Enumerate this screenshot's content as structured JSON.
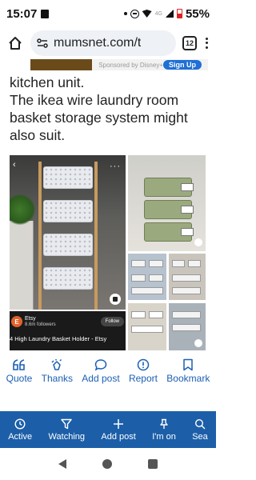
{
  "status_bar": {
    "time": "15:07",
    "network": "4G",
    "battery": "55%"
  },
  "browser": {
    "url": "mumsnet.com/t",
    "tab_count": "12"
  },
  "ad": {
    "sponsor_text": "Sponsored by Disney+",
    "cta_label": "Sign Up"
  },
  "post": {
    "lines": [
      "kitchen unit.",
      "The ikea wire laundry room basket storage system might also suit."
    ]
  },
  "pin": {
    "store_name": "Etsy",
    "followers": "8.6m followers",
    "follow_label": "Follow",
    "title": "4 High Laundry Basket Holder - Etsy"
  },
  "post_actions": [
    {
      "label": "Quote",
      "icon": "quote-icon"
    },
    {
      "label": "Thanks",
      "icon": "clap-icon"
    },
    {
      "label": "Add post",
      "icon": "comment-icon"
    },
    {
      "label": "Report",
      "icon": "report-icon"
    },
    {
      "label": "Bookmark",
      "icon": "bookmark-icon"
    }
  ],
  "bottom_nav": [
    {
      "label": "Active",
      "icon": "clock-icon"
    },
    {
      "label": "Watching",
      "icon": "filter-icon"
    },
    {
      "label": "Add post",
      "icon": "plus-icon"
    },
    {
      "label": "I'm on",
      "icon": "pin-icon"
    },
    {
      "label": "Sea",
      "icon": "search-icon"
    }
  ],
  "colors": {
    "accent": "#1b5fb3",
    "nav_bg": "#1c5fa8",
    "etsy_orange": "#e2622b"
  }
}
